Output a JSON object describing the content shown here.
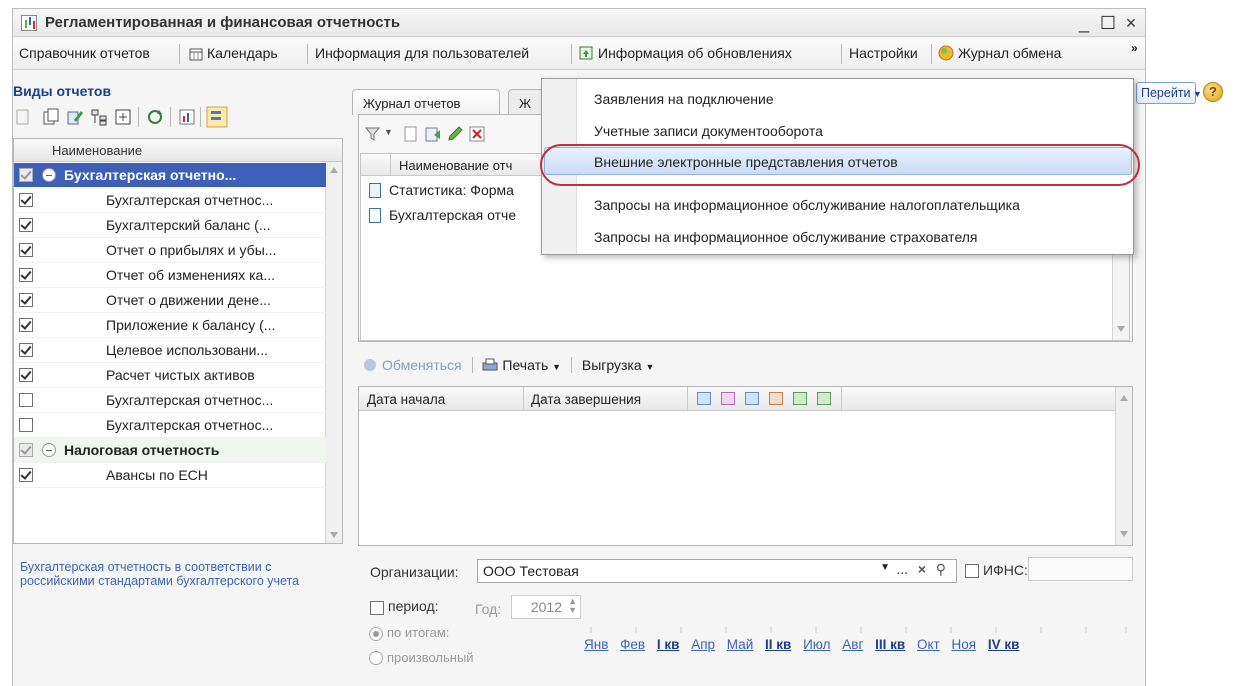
{
  "window": {
    "title": "Регламентированная и финансовая отчетность",
    "minimize": "_",
    "maximize": "☐",
    "close": "×"
  },
  "toolbar": {
    "items": [
      "Справочник отчетов",
      "Календарь",
      "Информация для пользователей",
      "Информация об обновлениях",
      "Настройки",
      "Журнал обмена"
    ],
    "overflow": "»"
  },
  "left": {
    "title": "Виды отчетов",
    "column_header": "Наименование",
    "rows": [
      {
        "label": "Бухгалтерская отчетно...",
        "checked": true,
        "kind": "group-selected"
      },
      {
        "label": "Бухгалтерская отчетнос...",
        "checked": true
      },
      {
        "label": "Бухгалтерский баланс (...",
        "checked": true
      },
      {
        "label": "Отчет о прибылях и убы...",
        "checked": true
      },
      {
        "label": "Отчет об изменениях ка...",
        "checked": true
      },
      {
        "label": "Отчет о движении дене...",
        "checked": true
      },
      {
        "label": "Приложение к балансу (...",
        "checked": true
      },
      {
        "label": "Целевое использовани...",
        "checked": true
      },
      {
        "label": "Расчет чистых активов",
        "checked": true
      },
      {
        "label": "Бухгалтерская отчетнос...",
        "checked": false
      },
      {
        "label": "Бухгалтерская отчетнос...",
        "checked": false
      },
      {
        "label": "Налоговая отчетность",
        "checked": true,
        "kind": "group"
      },
      {
        "label": "Авансы по ЕСН",
        "checked": true
      }
    ],
    "description": "Бухгалтерская отчетность в соответствии с российскими стандартами бухгалтерского учета"
  },
  "tabs": {
    "active": "Журнал отчетов",
    "second": "Ж"
  },
  "reports_list": {
    "column_header": "Наименование отч",
    "rows": [
      "Статистика: Форма",
      "Бухгалтерская отче"
    ]
  },
  "lower_toolbar": {
    "exchange": "Обменяться",
    "print": "Печать",
    "export": "Выгрузка"
  },
  "exchange_table": {
    "columns": [
      "Дата начала",
      "Дата завершения"
    ]
  },
  "form": {
    "org_label": "Организации:",
    "org_value": "ООО Тестовая",
    "ifns_label": "ИФНС:",
    "period_label": "период:",
    "year_label": "Год:",
    "year_value": "2012",
    "radio_totals": "по итогам:",
    "radio_custom": "произвольный",
    "months": [
      "Янв",
      "Фев",
      "I кв",
      "Апр",
      "Май",
      "II кв",
      "Июл",
      "Авг",
      "III кв",
      "Окт",
      "Ноя",
      "IV кв"
    ]
  },
  "dropdown": {
    "items": [
      "Заявления на подключение",
      "Учетные записи документооборота",
      "Внешние электронные представления отчетов",
      "Запросы на информационное обслуживание налогоплательщика",
      "Запросы на информационное обслуживание страхователя"
    ],
    "highlight_index": 2
  },
  "goto_button": "Перейти",
  "help": "?",
  "colors": {
    "selection": "#3c5fb8",
    "link": "#3b63b5",
    "ring": "#c0303a",
    "header_blue": "#1e3f8a"
  }
}
